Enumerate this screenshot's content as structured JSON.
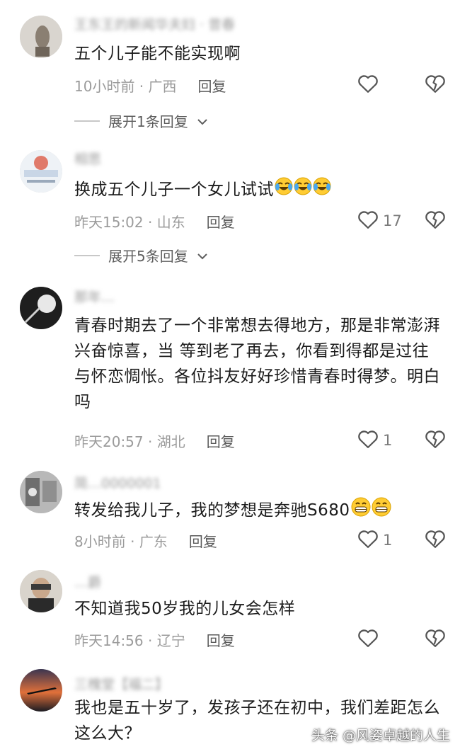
{
  "comments": [
    {
      "username": "王东王的新闻华夫妇 · 昔春",
      "text": "五个儿子能不能实现啊",
      "time": "10小时前",
      "location": "广西",
      "reply_label": "回复",
      "likes": "",
      "expand_label": "展开1条回复"
    },
    {
      "username": "相思",
      "text": "换成五个儿子一个女儿试试",
      "emoji_count": 3,
      "time": "昨天15:02",
      "location": "山东",
      "reply_label": "回复",
      "likes": "17",
      "expand_label": "展开5条回复"
    },
    {
      "username": "那年…",
      "text": "青春时期去了一个非常想去得地方，那是非常澎湃兴奋惊喜，当 等到老了再去，你看到得都是过往与怀恋惆怅。各位抖友好好珍惜青春时得梦。明白吗",
      "time": "昨天20:57",
      "location": "湖北",
      "reply_label": "回复",
      "likes": "1"
    },
    {
      "username": "简…0000001",
      "text": "转发给我儿子，我的梦想是奔驰S680",
      "emoji_count": 2,
      "time": "8小时前",
      "location": "广东",
      "reply_label": "回复",
      "likes": "1"
    },
    {
      "username": "…爵",
      "text": "不知道我50岁我的儿女会怎样",
      "time": "昨天14:56",
      "location": "辽宁",
      "reply_label": "回复",
      "likes": ""
    },
    {
      "username": "三槐堂【福二】",
      "text": "我也是五十岁了，发孩子还在初中，我们差距怎么这么大？"
    }
  ],
  "watermark": "头条 @风姿卓越的人生",
  "icons": {
    "like": "heart-outline-icon",
    "dislike": "broken-heart-icon",
    "expand": "chevron-down-icon",
    "emoji_laugh": "tears-of-joy-emoji",
    "emoji_grin": "grinning-emoji"
  },
  "colors": {
    "meta": "#9b9b9b",
    "text": "#1c1c1c",
    "reply": "#5a5a5a"
  }
}
